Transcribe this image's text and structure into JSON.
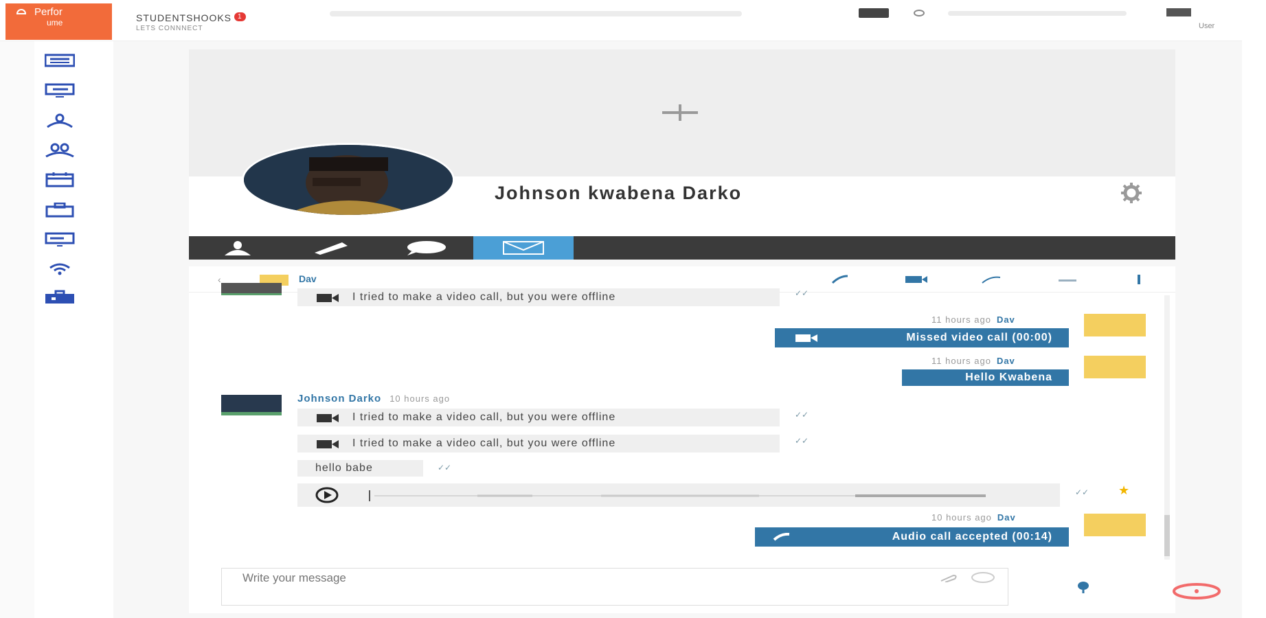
{
  "header": {
    "logo_line1": "Perfor",
    "logo_line2": "ume",
    "brand_name": "STUDENTSHOOKS",
    "notification_count": "1",
    "brand_tagline": "LETS CONNNECT",
    "user_label": "User"
  },
  "profile": {
    "name": "Johnson kwabena Darko"
  },
  "chat": {
    "contact_name": "Dav",
    "messages": [
      {
        "type": "incoming",
        "text": "I tried to make a video call, but you were offline"
      },
      {
        "type": "outgoing",
        "meta_time": "11 hours ago",
        "meta_sender": "Dav",
        "text": "Missed video call (00:00)"
      },
      {
        "type": "outgoing",
        "meta_time": "11 hours ago",
        "meta_sender": "Dav",
        "text": "Hello Kwabena"
      },
      {
        "type": "incoming_group",
        "sender": "Johnson Darko",
        "time": "10 hours ago"
      },
      {
        "type": "incoming",
        "text": "I tried to make a video call, but you were offline"
      },
      {
        "type": "incoming",
        "text": "I tried to make a video call, but you were offline"
      },
      {
        "type": "incoming",
        "text": "hello babe"
      },
      {
        "type": "outgoing",
        "meta_time": "10 hours ago",
        "meta_sender": "Dav",
        "text": "Audio call accepted (00:14)"
      }
    ],
    "composer_placeholder": "Write your message"
  },
  "colors": {
    "brand_orange": "#f26b3a",
    "accent_blue": "#3276a6",
    "active_tab": "#4b9fd6",
    "tab_bar": "#3b3b3b",
    "dav_avatar": "#f4cf5f",
    "notif_red": "#e53935"
  },
  "icons": {
    "sidebar": [
      "news-icon",
      "feed-icon",
      "user-group-icon",
      "friends-icon",
      "calendar-icon",
      "briefcase-icon",
      "board-icon",
      "wifi-icon",
      "toolbox-icon"
    ],
    "tabs": [
      "user-icon",
      "pencil-icon",
      "chat-bubble-icon",
      "mail-icon"
    ],
    "chat_header": [
      "back-icon",
      "phone-icon",
      "video-icon",
      "phone-missed-icon",
      "minimize-icon",
      "more-icon"
    ]
  }
}
